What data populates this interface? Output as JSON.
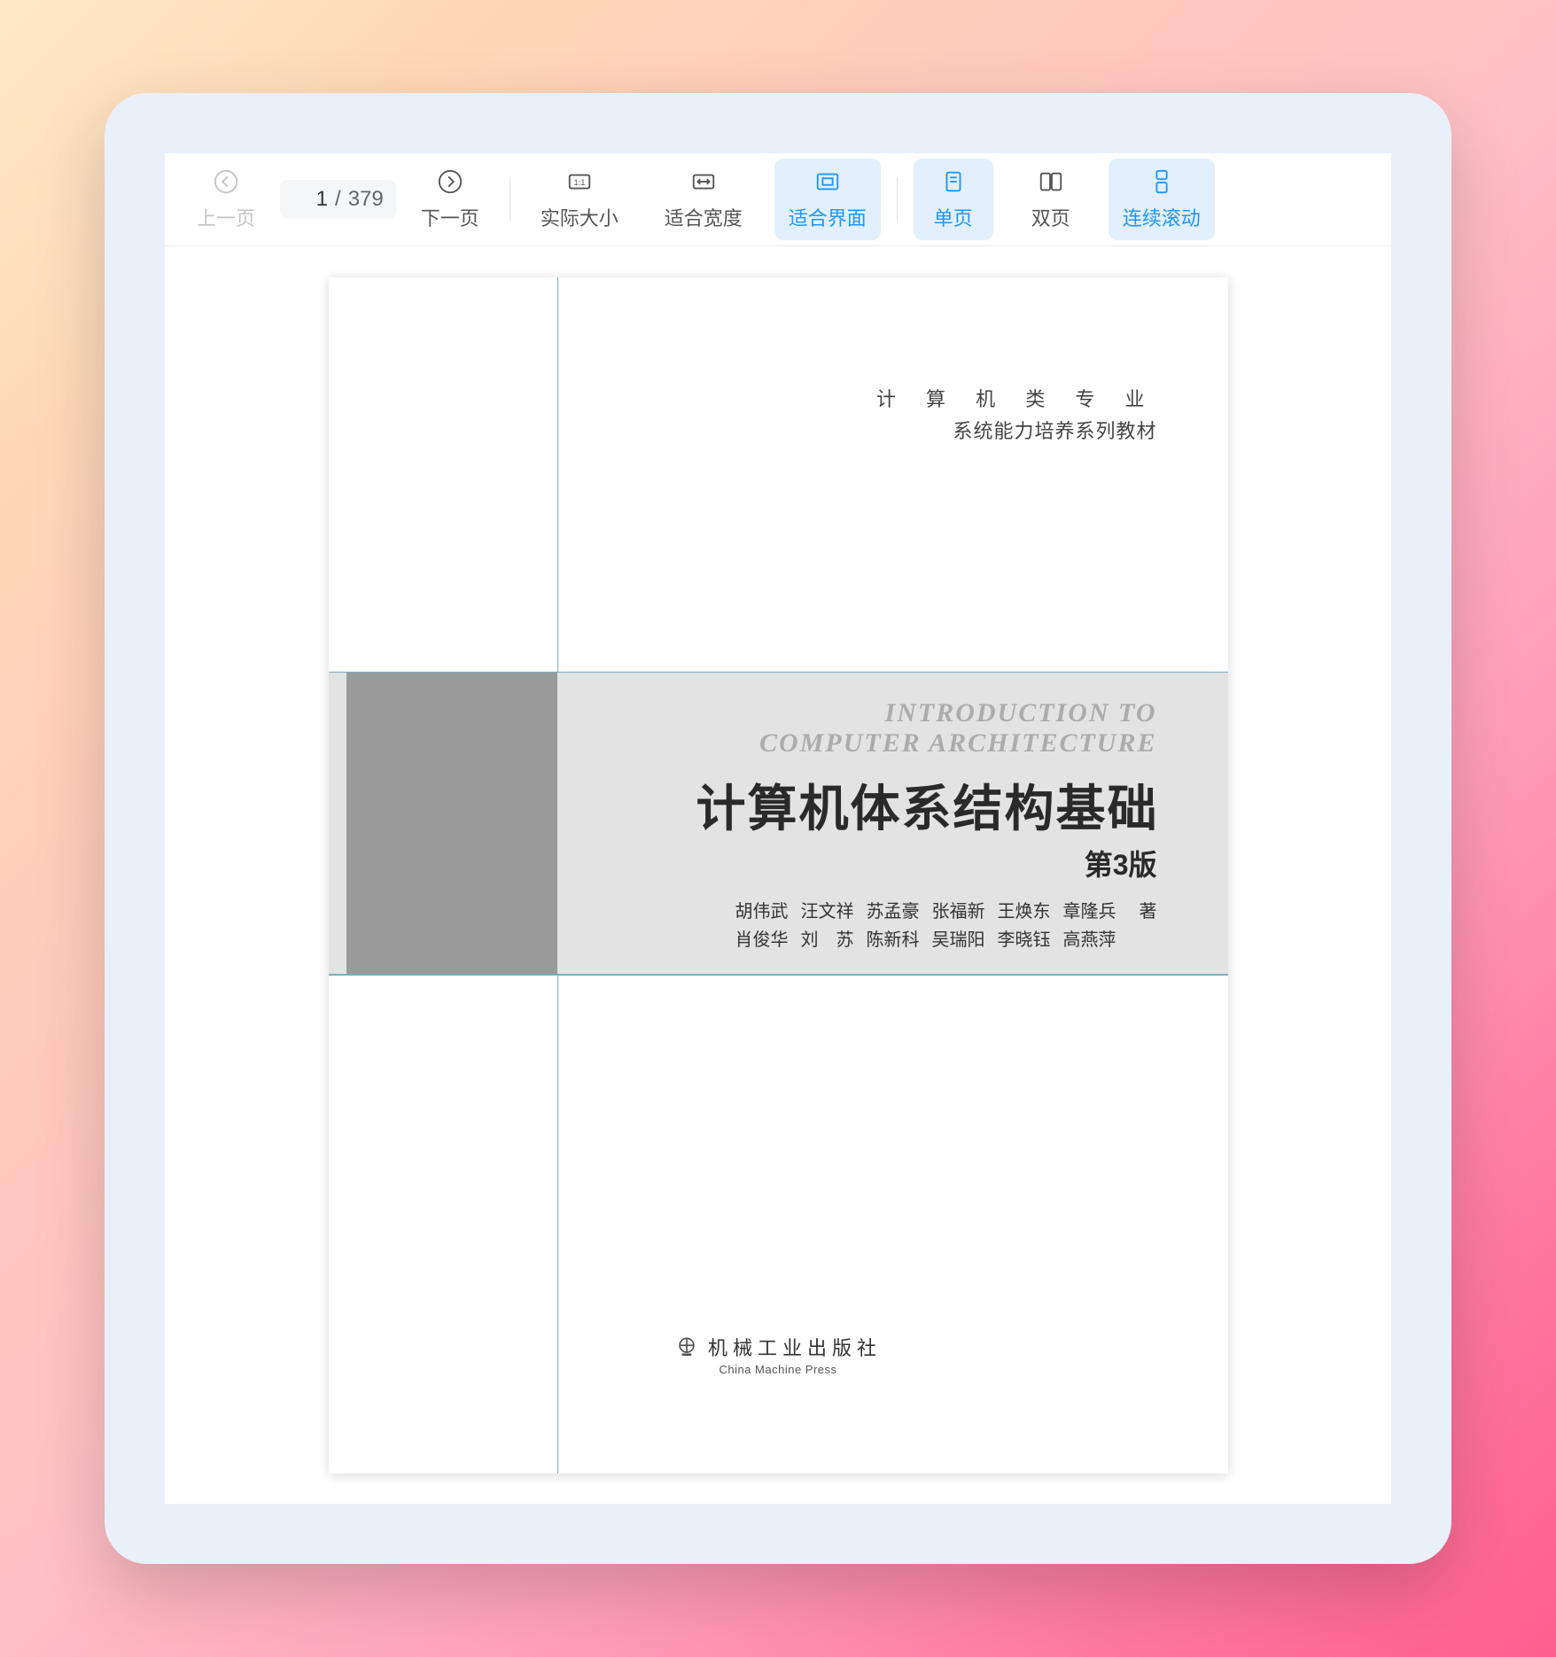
{
  "toolbar": {
    "prev_label": "上一页",
    "next_label": "下一页",
    "actual_size_label": "实际大小",
    "fit_width_label": "适合宽度",
    "fit_page_label": "适合界面",
    "single_page_label": "单页",
    "double_page_label": "双页",
    "continuous_label": "连续滚动",
    "current_page": "1",
    "page_separator": "/",
    "total_pages": "379"
  },
  "document": {
    "series_line1": "计 算 机 类 专 业",
    "series_line2": "系统能力培养系列教材",
    "eng_title_line1": "INTRODUCTION  TO",
    "eng_title_line2": "COMPUTER  ARCHITECTURE",
    "cn_title": "计算机体系结构基础",
    "edition": "第3版",
    "authors_line1": [
      "胡伟武",
      "汪文祥",
      "苏孟豪",
      "张福新",
      "王焕东",
      "章隆兵"
    ],
    "authors_line2": [
      "肖俊华",
      "刘　苏",
      "陈新科",
      "吴瑞阳",
      "李晓钰",
      "高燕萍"
    ],
    "author_suffix": "著",
    "publisher_cn": "机械工业出版社",
    "publisher_en": "China Machine Press"
  }
}
